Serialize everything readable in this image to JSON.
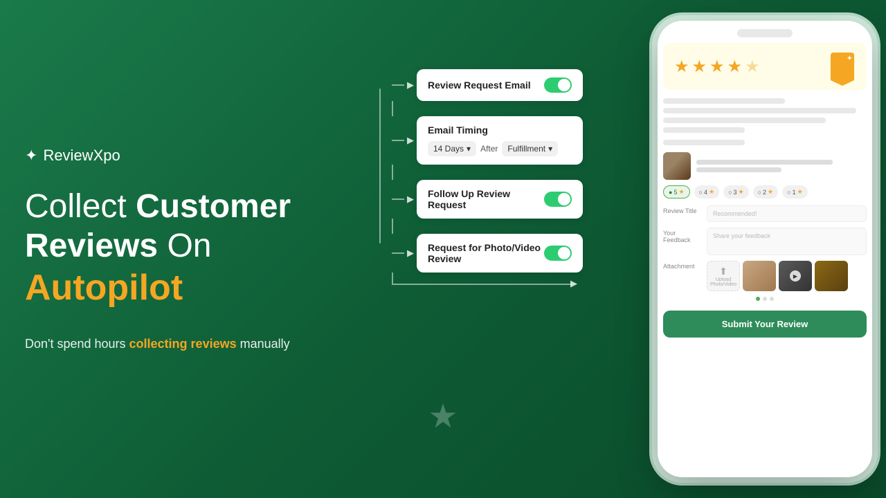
{
  "brand": {
    "name": "ReviewXpo",
    "logo_star": "✦"
  },
  "headline": {
    "part1": "Collect ",
    "part2": "Customer Reviews",
    "part3": " On",
    "part4": "Autopilot"
  },
  "subtext": {
    "prefix": "Don't spend hours ",
    "highlight": "collecting reviews",
    "suffix": " manually"
  },
  "flow": {
    "items": [
      {
        "id": "review-request-email",
        "label": "Review Request Email",
        "toggled": true
      },
      {
        "id": "email-timing",
        "label": "Email Timing",
        "timing_days": "14 Days",
        "timing_after": "After",
        "timing_trigger": "Fulfillment"
      },
      {
        "id": "follow-up-review-request",
        "label": "Follow Up Review Request",
        "toggled": true
      },
      {
        "id": "request-photo-video",
        "label": "Request for Photo/Video Review",
        "toggled": true
      }
    ]
  },
  "phone": {
    "stars": [
      {
        "filled": true
      },
      {
        "filled": true
      },
      {
        "filled": true
      },
      {
        "filled": true
      },
      {
        "filled": false
      }
    ],
    "rating_filters": [
      {
        "label": "5",
        "count": "",
        "active": true
      },
      {
        "label": "4",
        "count": "",
        "active": false
      },
      {
        "label": "3",
        "count": "",
        "active": false
      },
      {
        "label": "2",
        "count": "",
        "active": false
      },
      {
        "label": "1",
        "count": "",
        "active": false
      }
    ],
    "form": {
      "review_title_label": "Review Title",
      "review_title_placeholder": "Recommended!",
      "feedback_label": "Your Feedback",
      "feedback_placeholder": "Share your feedback",
      "attachment_label": "Attachment",
      "upload_text": "Upload Photo/Video"
    },
    "submit_label": "Submit Your Review",
    "dots": [
      true,
      false,
      false
    ]
  },
  "deco": {
    "star": "★"
  }
}
